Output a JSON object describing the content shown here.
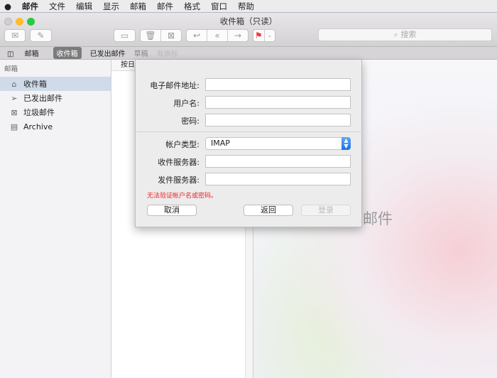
{
  "menubar": {
    "apple": "",
    "items": [
      "邮件",
      "文件",
      "编辑",
      "显示",
      "邮箱",
      "邮件",
      "格式",
      "窗口",
      "帮助"
    ]
  },
  "window": {
    "title": "收件箱（只读）"
  },
  "toolbar": {
    "search_placeholder": "搜索",
    "flag_color": "#f0353c"
  },
  "favorites": {
    "mailboxes": "邮箱",
    "inbox": "收件箱",
    "sent": "已发出邮件",
    "drafts": "草稿",
    "flagged": "有旗标"
  },
  "sidebar": {
    "header": "邮箱",
    "items": [
      {
        "label": "收件箱",
        "icon": "tray-icon"
      },
      {
        "label": "已发出邮件",
        "icon": "paperplane-icon"
      },
      {
        "label": "垃圾邮件",
        "icon": "junk-icon"
      },
      {
        "label": "Archive",
        "icon": "archive-icon"
      }
    ]
  },
  "list": {
    "sort_label": "按日期"
  },
  "preview": {
    "no_message": "未选择邮件"
  },
  "sheet": {
    "email_label": "电子邮件地址:",
    "email_value": "",
    "username_label": "用户名:",
    "username_value": "",
    "password_label": "密码:",
    "password_value": "",
    "account_type_label": "帐户类型:",
    "account_type_value": "IMAP",
    "incoming_label": "收件服务器:",
    "incoming_value": "",
    "outgoing_label": "发件服务器:",
    "outgoing_value": "",
    "error": "无法验证帐户名或密码。",
    "cancel": "取消",
    "back": "返回",
    "sign_in": "登录"
  }
}
